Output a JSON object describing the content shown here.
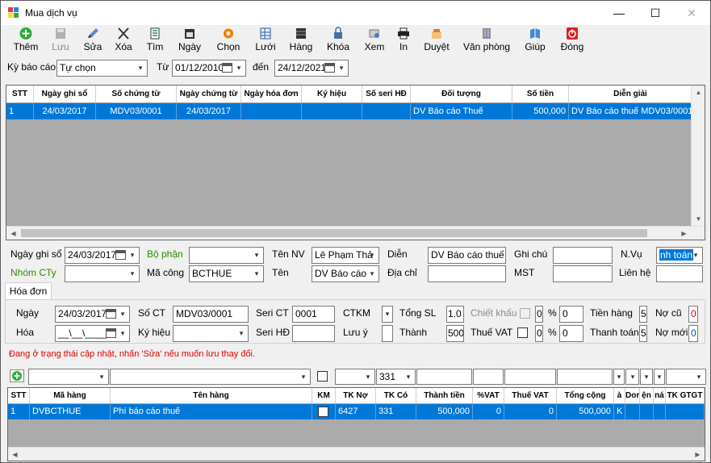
{
  "window": {
    "title": "Mua dịch vụ",
    "minimize": "—",
    "maximize": "☐",
    "close": "✕"
  },
  "toolbar": {
    "them": "Thêm",
    "luu": "Lưu",
    "sua": "Sửa",
    "xoa": "Xóa",
    "tim": "Tìm",
    "ngay": "Ngày",
    "chon": "Chọn",
    "luoi": "Lưới",
    "hang": "Hàng",
    "khoa": "Khóa",
    "xem": "Xem",
    "in": "In",
    "duyet": "Duyệt",
    "van_phong": "Văn phòng",
    "giup": "Giúp",
    "dong": "Đóng"
  },
  "filter": {
    "ky_bao_cao_label": "Kỳ báo cáo",
    "ky_bao_cao_value": "Tự chọn",
    "tu_label": "Từ",
    "tu_value": "01/12/2010",
    "den_label": "đến",
    "den_value": "24/12/2021"
  },
  "main_grid": {
    "headers": [
      "STT",
      "Ngày ghi sổ",
      "Số chứng từ",
      "Ngày chứng từ",
      "Ngày hóa đơn",
      "Ký hiệu",
      "Số seri HĐ",
      "Đối tượng",
      "Số tiền",
      "Diễn giải"
    ],
    "rows": [
      [
        "1",
        "24/03/2017",
        "MDV03/0001",
        "24/03/2017",
        "",
        "",
        "",
        "DV Báo cáo Thuế",
        "500,000",
        "DV Báo cáo thuế MDV03/0001"
      ]
    ]
  },
  "form": {
    "ngay_ghi_so_label": "Ngày ghi sổ",
    "ngay_ghi_so_value": "24/03/2017",
    "bo_phan_label": "Bộ phận",
    "bo_phan_value": "",
    "ten_nv_label": "Tên NV",
    "ten_nv_value": "Lê Phạm Thả",
    "dien_label": "Diễn",
    "dien_value": "DV Báo cáo thuế M",
    "ghi_chu_label": "Ghi chú",
    "ghi_chu_value": "",
    "nvu_label": "N.Vụ",
    "nvu_value": "nh toán",
    "nhom_cty_label": "Nhóm CTy",
    "nhom_cty_value": "",
    "ma_cong_label": "Mã công",
    "ma_cong_value": "BCTHUE",
    "ten_label": "Tên",
    "ten_value": "DV Báo cáo",
    "dia_chi_label": "Địa chỉ",
    "dia_chi_value": "",
    "mst_label": "MST",
    "mst_value": "",
    "lien_he_label": "Liên hệ",
    "lien_he_value": ""
  },
  "tab": {
    "hoa_don_label": "Hóa đơn"
  },
  "invoice": {
    "ngay_label": "Ngày",
    "ngay_value": "24/03/2017",
    "so_ct_label": "Số CT",
    "so_ct_value": "MDV03/0001",
    "seri_ct_label": "Seri CT",
    "seri_ct_value": "0001",
    "ctkm_label": "CTKM",
    "tong_sl_label": "Tổng SL",
    "tong_sl_value": "1.0",
    "chiet_khau_label": "Chiết khấu",
    "chiet_khau_pct": "0",
    "chiet_khau_amount": "0",
    "pct_sign": "%",
    "tien_hang_label": "Tiền hàng",
    "tien_hang_value": "5",
    "no_cu_label": "Nợ cũ",
    "no_cu_value": "0",
    "hoa_label": "Hóa",
    "hoa_value": "__\\__\\____",
    "ky_hieu_label": "Ký hiệu",
    "ky_hieu_value": "",
    "seri_hd_label": "Seri HĐ",
    "seri_hd_value": "",
    "luu_y_label": "Lưu ý",
    "thanh_label": "Thành",
    "thanh_value": "500",
    "thue_vat_label": "Thuế VAT",
    "thue_vat_pct": "0",
    "thue_vat_amount": "0",
    "thanh_toan_label": "Thanh toán",
    "thanh_toan_value": "5",
    "no_moi_label": "Nợ mới",
    "no_moi_value": "0"
  },
  "status_text": "Đang ở trạng thái cập nhật, nhấn 'Sửa' nếu muốn lưu thay đổi.",
  "detail_filter": {
    "tk_co_value": "331"
  },
  "detail_grid": {
    "headers": [
      "STT",
      "Mã hàng",
      "Tên hàng",
      "KM",
      "TK Nợ",
      "TK Có",
      "Thành tiền",
      "%VAT",
      "Thuế VAT",
      "Tổng cộng",
      "à",
      "Dor",
      "ện",
      "ná",
      "TK GTGT"
    ],
    "rows": [
      [
        "1",
        "DVBCTHUE",
        "Phí báo cáo thuế",
        "",
        "6427",
        "331",
        "500,000",
        "0",
        "0",
        "500,000",
        "K",
        "",
        "",
        "",
        ""
      ]
    ]
  },
  "colors": {
    "selection": "#0078d7",
    "green_label": "#2e8b00",
    "status_red": "#e00000",
    "grid_bg": "#ababab"
  }
}
